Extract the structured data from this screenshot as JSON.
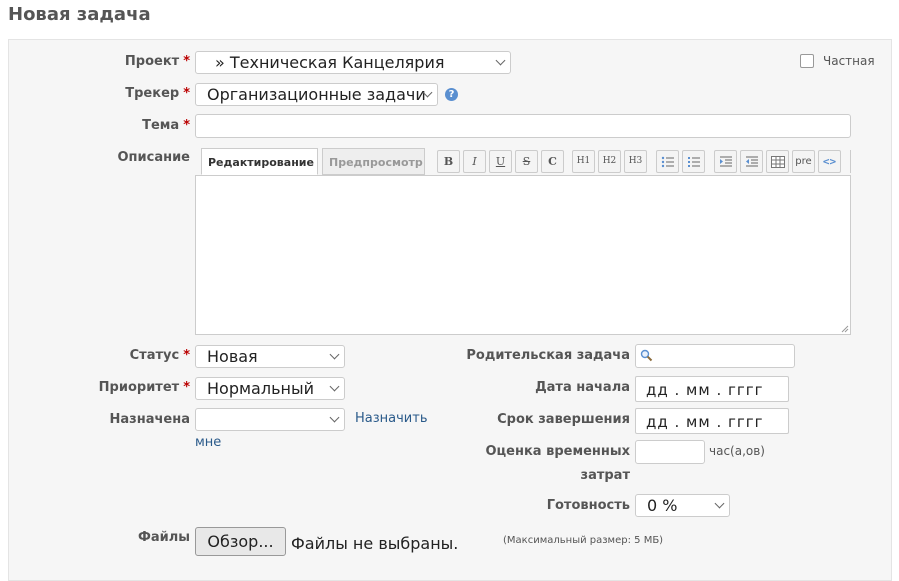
{
  "page_title": "Новая задача",
  "private": {
    "label": "Частная",
    "checked": false
  },
  "fields": {
    "project": {
      "label": "Проект",
      "required": "*",
      "value": "» Техническая Канцелярия"
    },
    "tracker": {
      "label": "Трекер",
      "required": "*",
      "value": "Организационные задачи"
    },
    "subject": {
      "label": "Тема",
      "required": "*",
      "value": ""
    },
    "description": {
      "label": "Описание"
    },
    "status": {
      "label": "Статус",
      "required": "*",
      "value": "Новая"
    },
    "priority": {
      "label": "Приоритет",
      "required": "*",
      "value": "Нормальный"
    },
    "assignee": {
      "label": "Назначена",
      "value": "",
      "assign_to_me": "Назначить",
      "assign_to_me_2": "мне"
    },
    "parent_task": {
      "label": "Родительская задача",
      "value": ""
    },
    "start_date": {
      "label": "Дата начала",
      "placeholder": "дд . мм . гггг"
    },
    "due_date": {
      "label": "Срок завершения",
      "placeholder": "дд . мм . гггг"
    },
    "estimated": {
      "label_line1": "Оценка временных",
      "label_line2": "затрат",
      "unit": "час(а,ов)",
      "value": ""
    },
    "done_ratio": {
      "label": "Готовность",
      "value": "0 %"
    },
    "files": {
      "label": "Файлы",
      "browse": "Обзор...",
      "no_file": "Файлы не выбраны.",
      "max_size": "(Максимальный размер: 5 МБ)"
    }
  },
  "editor": {
    "tab_edit": "Редактирование",
    "tab_preview": "Предпросмотр",
    "toolbar": {
      "bold": "B",
      "italic": "I",
      "underline": "U",
      "strike": "S",
      "code": "C",
      "h1": "H1",
      "h2": "H2",
      "h3": "H3",
      "pre": "pre",
      "link": "<>"
    }
  }
}
